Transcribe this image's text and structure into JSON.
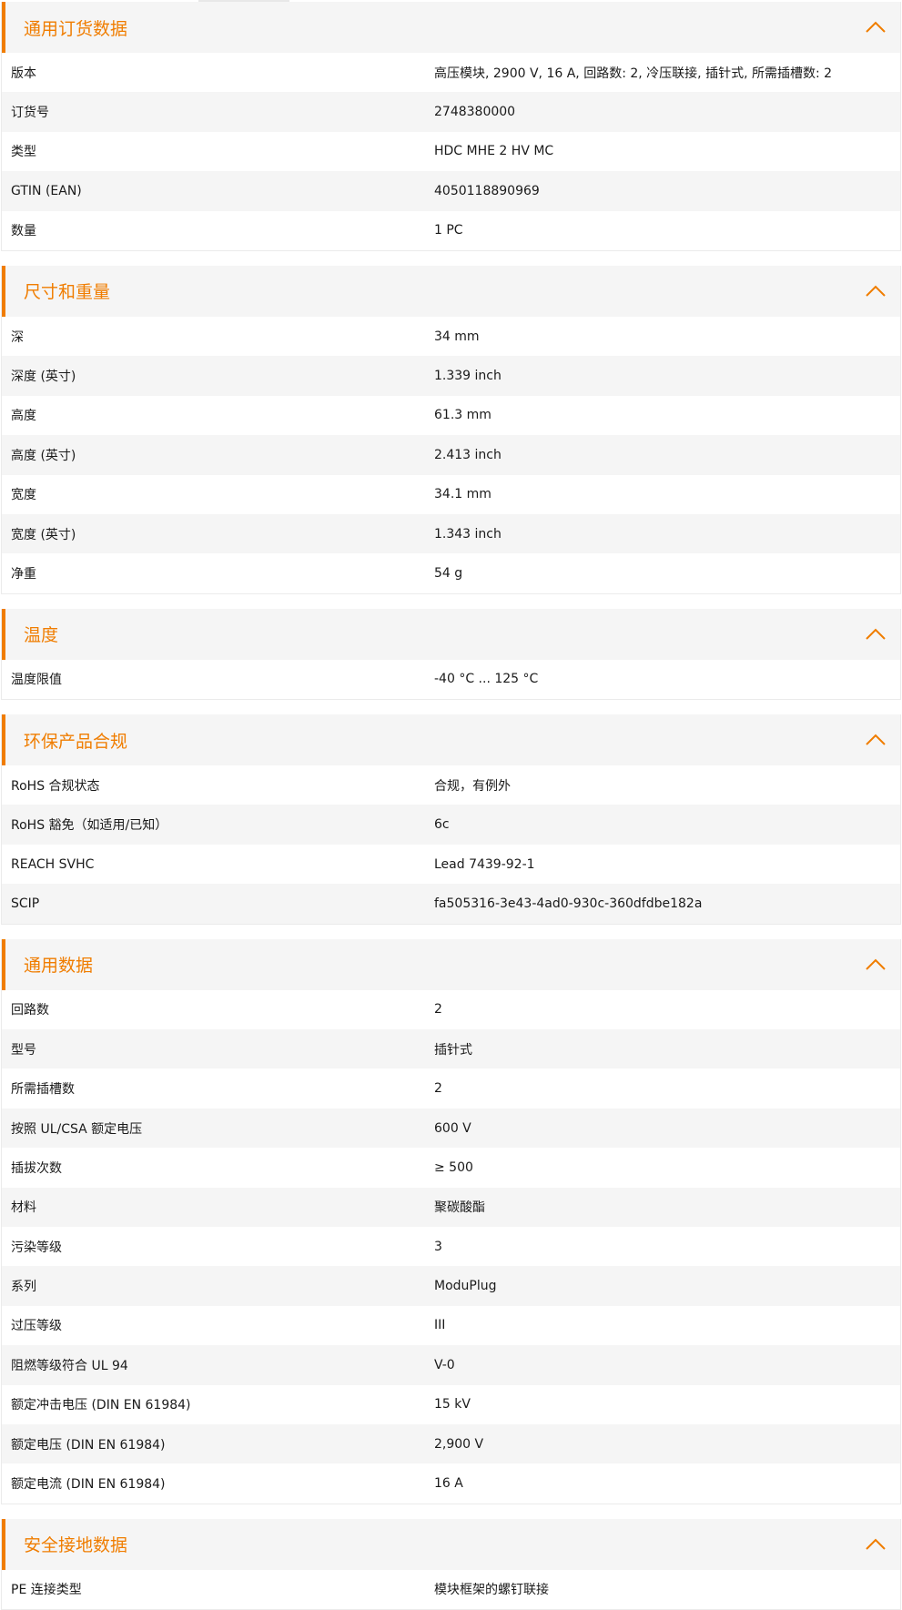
{
  "colors": {
    "accent": "#f07d00",
    "row_alt": "#f5f5f5",
    "text": "#1a1a1a"
  },
  "icons": {
    "collapse": "chevron-up-icon"
  },
  "sections": [
    {
      "title": "通用订货数据",
      "rows": [
        {
          "label": "版本",
          "value": "高压模块, 2900 V, 16 A, 回路数: 2, 冷压联接, 插针式, 所需插槽数: 2"
        },
        {
          "label": "订货号",
          "value": "2748380000"
        },
        {
          "label": "类型",
          "value": "HDC MHE 2 HV MC"
        },
        {
          "label": "GTIN (EAN)",
          "value": "4050118890969"
        },
        {
          "label": "数量",
          "value": "1  PC"
        }
      ]
    },
    {
      "title": "尺寸和重量",
      "rows": [
        {
          "label": "深",
          "value": "34  mm"
        },
        {
          "label": "深度 (英寸)",
          "value": "1.339  inch"
        },
        {
          "label": "高度",
          "value": "61.3  mm"
        },
        {
          "label": "高度 (英寸)",
          "value": "2.413  inch"
        },
        {
          "label": "宽度",
          "value": "34.1  mm"
        },
        {
          "label": "宽度 (英寸)",
          "value": "1.343  inch"
        },
        {
          "label": "净重",
          "value": "54  g"
        }
      ]
    },
    {
      "title": "温度",
      "rows": [
        {
          "label": "温度限值",
          "value": "-40 °C ... 125 °C"
        }
      ]
    },
    {
      "title": "环保产品合规",
      "rows": [
        {
          "label": "RoHS 合规状态",
          "value": "合规，有例外"
        },
        {
          "label": "RoHS 豁免（如适用/已知）",
          "value": "6c"
        },
        {
          "label": "REACH SVHC",
          "value": "Lead 7439-92-1"
        },
        {
          "label": "SCIP",
          "value": "fa505316-3e43-4ad0-930c-360dfdbe182a"
        }
      ]
    },
    {
      "title": "通用数据",
      "rows": [
        {
          "label": "回路数",
          "value": "2"
        },
        {
          "label": "型号",
          "value": "插针式"
        },
        {
          "label": "所需插槽数",
          "value": "2"
        },
        {
          "label": "按照 UL/CSA 额定电压",
          "value": "600 V"
        },
        {
          "label": "插拔次数",
          "value": "≥ 500"
        },
        {
          "label": "材料",
          "value": "聚碳酸酯"
        },
        {
          "label": "污染等级",
          "value": "3"
        },
        {
          "label": "系列",
          "value": "ModuPlug"
        },
        {
          "label": "过压等级",
          "value": "III"
        },
        {
          "label": "阻燃等级符合 UL 94",
          "value": "V-0"
        },
        {
          "label": "额定冲击电压 (DIN EN 61984)",
          "value": "15  kV"
        },
        {
          "label": "额定电压 (DIN EN 61984)",
          "value": "2,900  V"
        },
        {
          "label": "额定电流 (DIN EN 61984)",
          "value": "16  A"
        }
      ]
    },
    {
      "title": "安全接地数据",
      "rows": [
        {
          "label": "PE 连接类型",
          "value": "模块框架的螺钉联接"
        }
      ]
    }
  ]
}
